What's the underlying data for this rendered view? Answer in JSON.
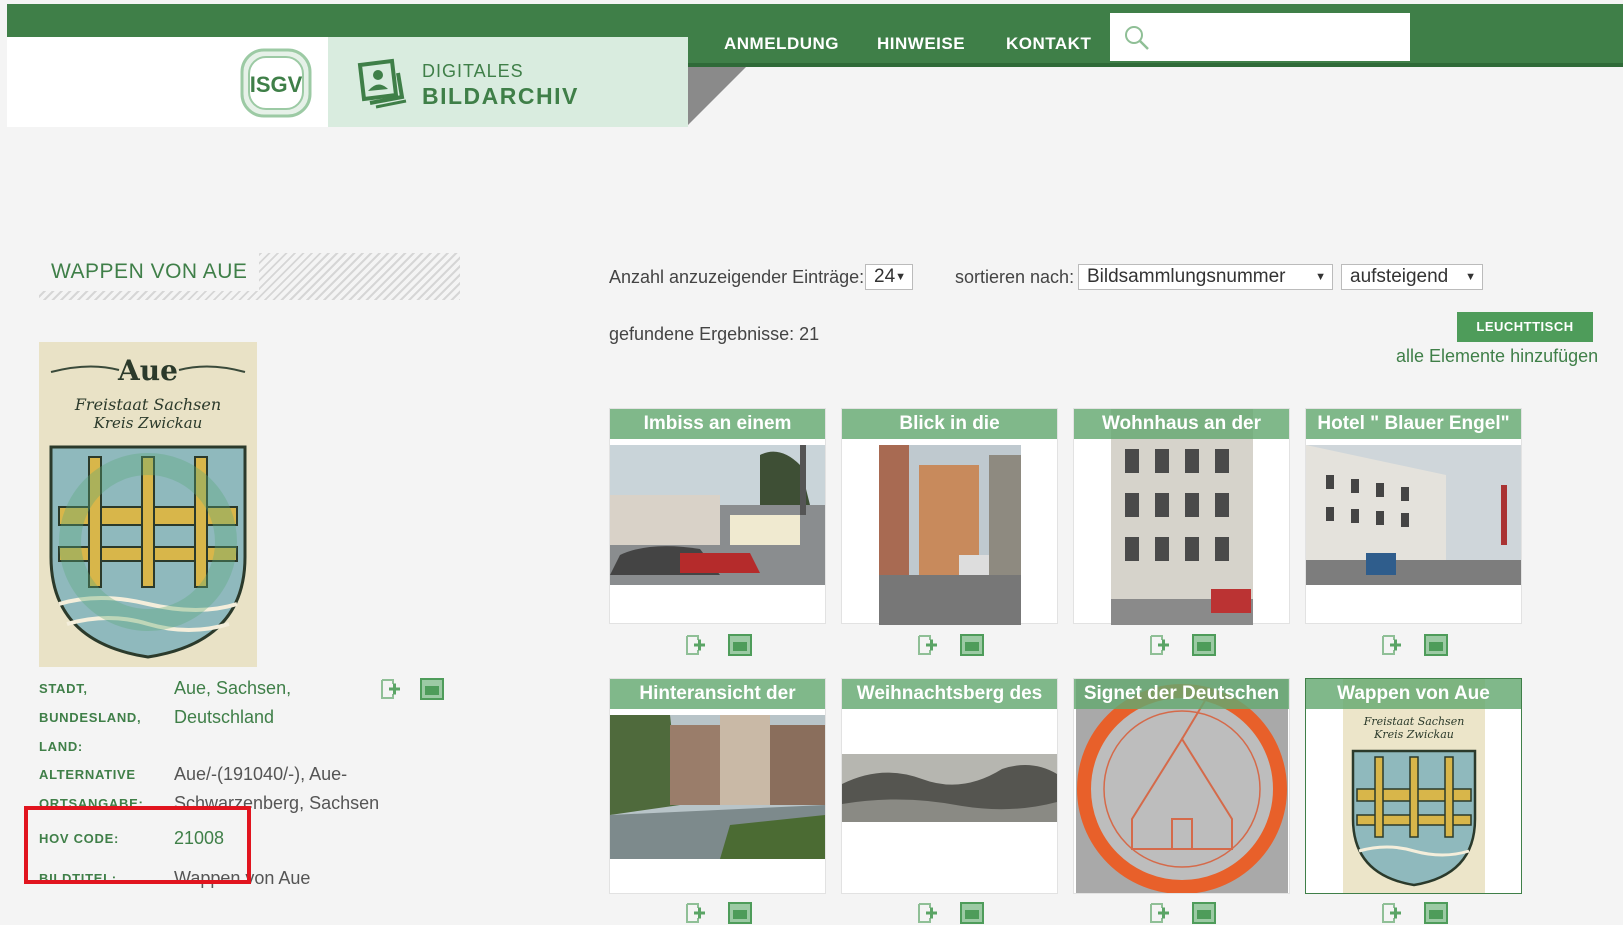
{
  "header": {
    "logo_text": "ISGV",
    "brand_line1": "DIGITALES",
    "brand_line2": "BILDARCHIV",
    "nav": [
      "ANMELDUNG",
      "HINWEISE",
      "KONTAKT"
    ],
    "search": {
      "value": "",
      "placeholder": ""
    }
  },
  "record": {
    "title": "WAPPEN VON AUE",
    "image_caption_line1": "Aue",
    "image_caption_line2": "Freistaat Sachsen",
    "image_caption_line3": "Kreis Zwickau",
    "fields": [
      {
        "label_lines": [
          "STADT,",
          "BUNDESLAND,",
          "LAND:"
        ],
        "value": "Aue, Sachsen, Deutschland"
      },
      {
        "label_lines": [
          "ALTERNATIVE",
          "ORTSANGABE:"
        ],
        "value": "Aue/-(191040/-), Aue-Schwarzenberg, Sachsen"
      },
      {
        "label_lines": [
          "HOV CODE:"
        ],
        "value": "21008"
      },
      {
        "label_lines": [
          "BILDTITEL:"
        ],
        "value": "Wappen von Aue"
      }
    ]
  },
  "controls": {
    "entries_label": "Anzahl anzuzeigender Einträge:",
    "entries_value": "24",
    "sort_label": "sortieren nach:",
    "sort_value": "Bildsammlungsnummer",
    "order_value": "aufsteigend",
    "found": "gefundene Ergebnisse: 21",
    "lighttable_button": "LEUCHTTISCH",
    "add_all": "alle Elemente hinzufügen"
  },
  "results": [
    {
      "title": "Imbiss an einem"
    },
    {
      "title": "Blick in die"
    },
    {
      "title": "Wohnhaus an der"
    },
    {
      "title": "Hotel \" Blauer Engel\""
    },
    {
      "title": "Hinteransicht der"
    },
    {
      "title": "Weihnachtsberg des"
    },
    {
      "title": "Signet der Deutschen"
    },
    {
      "title": "Wappen von Aue",
      "caption1": "Freistaat Sachsen",
      "caption2": "Kreis Zwickau"
    }
  ],
  "colors": {
    "brand_green": "#3f7f48",
    "light_green": "#d9ecdf",
    "highlight_red": "#e1141e"
  }
}
